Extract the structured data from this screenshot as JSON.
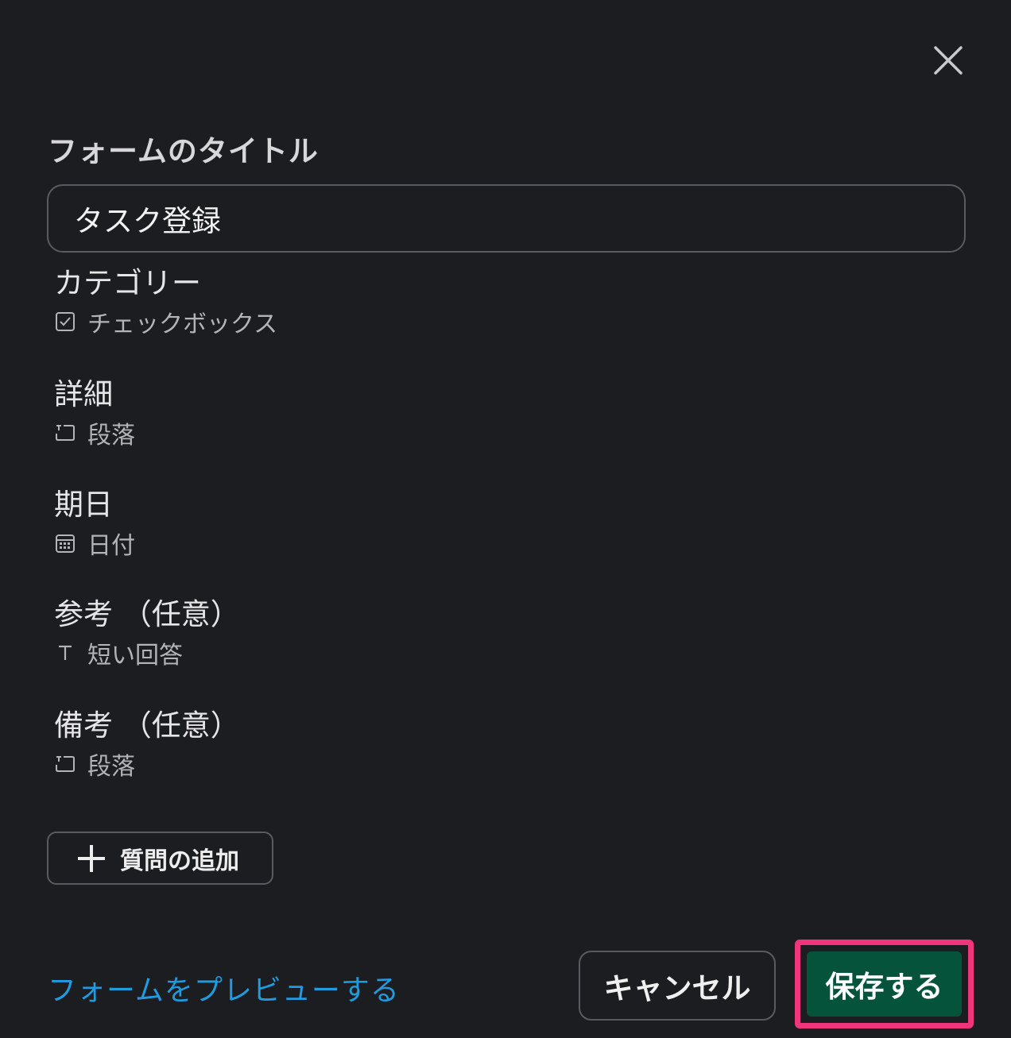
{
  "dialog": {
    "close_icon": "close-icon"
  },
  "form": {
    "title_label": "フォームのタイトル",
    "title_value": "タスク登録"
  },
  "questions": [
    {
      "title": "カテゴリー",
      "type_label": "チェックボックス",
      "type_icon": "checkbox-icon"
    },
    {
      "title": "詳細",
      "type_label": "段落",
      "type_icon": "paragraph-icon"
    },
    {
      "title": "期日",
      "type_label": "日付",
      "type_icon": "calendar-icon"
    },
    {
      "title": "参考 （任意）",
      "type_label": "短い回答",
      "type_icon": "text-icon"
    },
    {
      "title": "備考 （任意）",
      "type_label": "段落",
      "type_icon": "paragraph-icon"
    }
  ],
  "actions": {
    "add_question_label": "質問の追加",
    "preview_link": "フォームをプレビューする",
    "cancel_label": "キャンセル",
    "save_label": "保存する"
  },
  "colors": {
    "background": "#1c1d21",
    "link": "#1f9be0",
    "save_button": "#06533c",
    "highlight": "#f0357b"
  }
}
